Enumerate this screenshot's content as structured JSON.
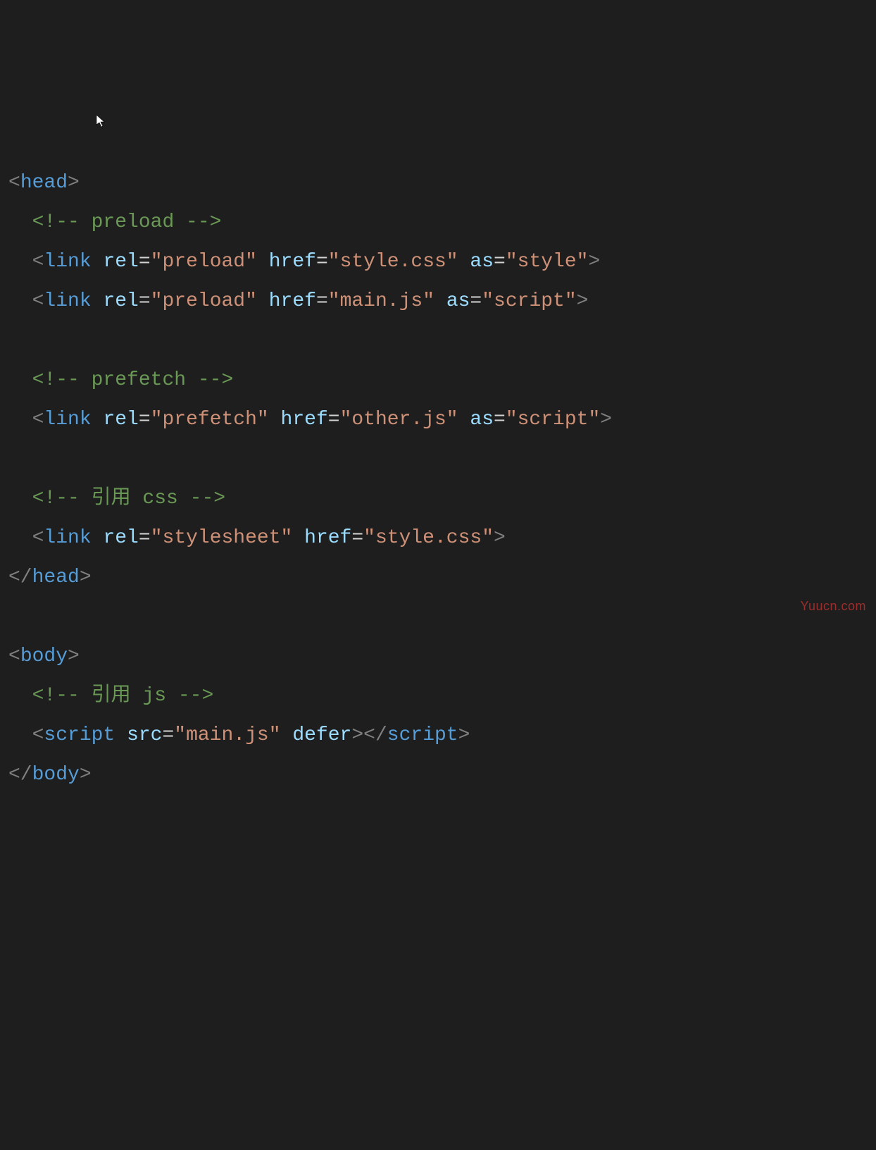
{
  "code": {
    "head_open": "head",
    "comment_preload": "<!-- preload -->",
    "link1": {
      "tag": "link",
      "rel_attr": "rel",
      "rel_val": "\"preload\"",
      "href_attr": "href",
      "href_val": "\"style.css\"",
      "as_attr": "as",
      "as_val": "\"style\""
    },
    "link2": {
      "tag": "link",
      "rel_attr": "rel",
      "rel_val": "\"preload\"",
      "href_attr": "href",
      "href_val": "\"main.js\"",
      "as_attr": "as",
      "as_val": "\"script\""
    },
    "comment_prefetch": "<!-- prefetch -->",
    "link3": {
      "tag": "link",
      "rel_attr": "rel",
      "rel_val": "\"prefetch\"",
      "href_attr": "href",
      "href_val": "\"other.js\"",
      "as_attr": "as",
      "as_val": "\"script\""
    },
    "comment_css": "<!-- 引用 css -->",
    "link4": {
      "tag": "link",
      "rel_attr": "rel",
      "rel_val": "\"stylesheet\"",
      "href_attr": "href",
      "href_val": "\"style.css\""
    },
    "head_close": "head",
    "body_open": "body",
    "comment_js": "<!-- 引用 js -->",
    "script": {
      "tag": "script",
      "src_attr": "src",
      "src_val": "\"main.js\"",
      "defer_attr": "defer"
    },
    "body_close": "body"
  },
  "watermark": "Yuucn.com"
}
